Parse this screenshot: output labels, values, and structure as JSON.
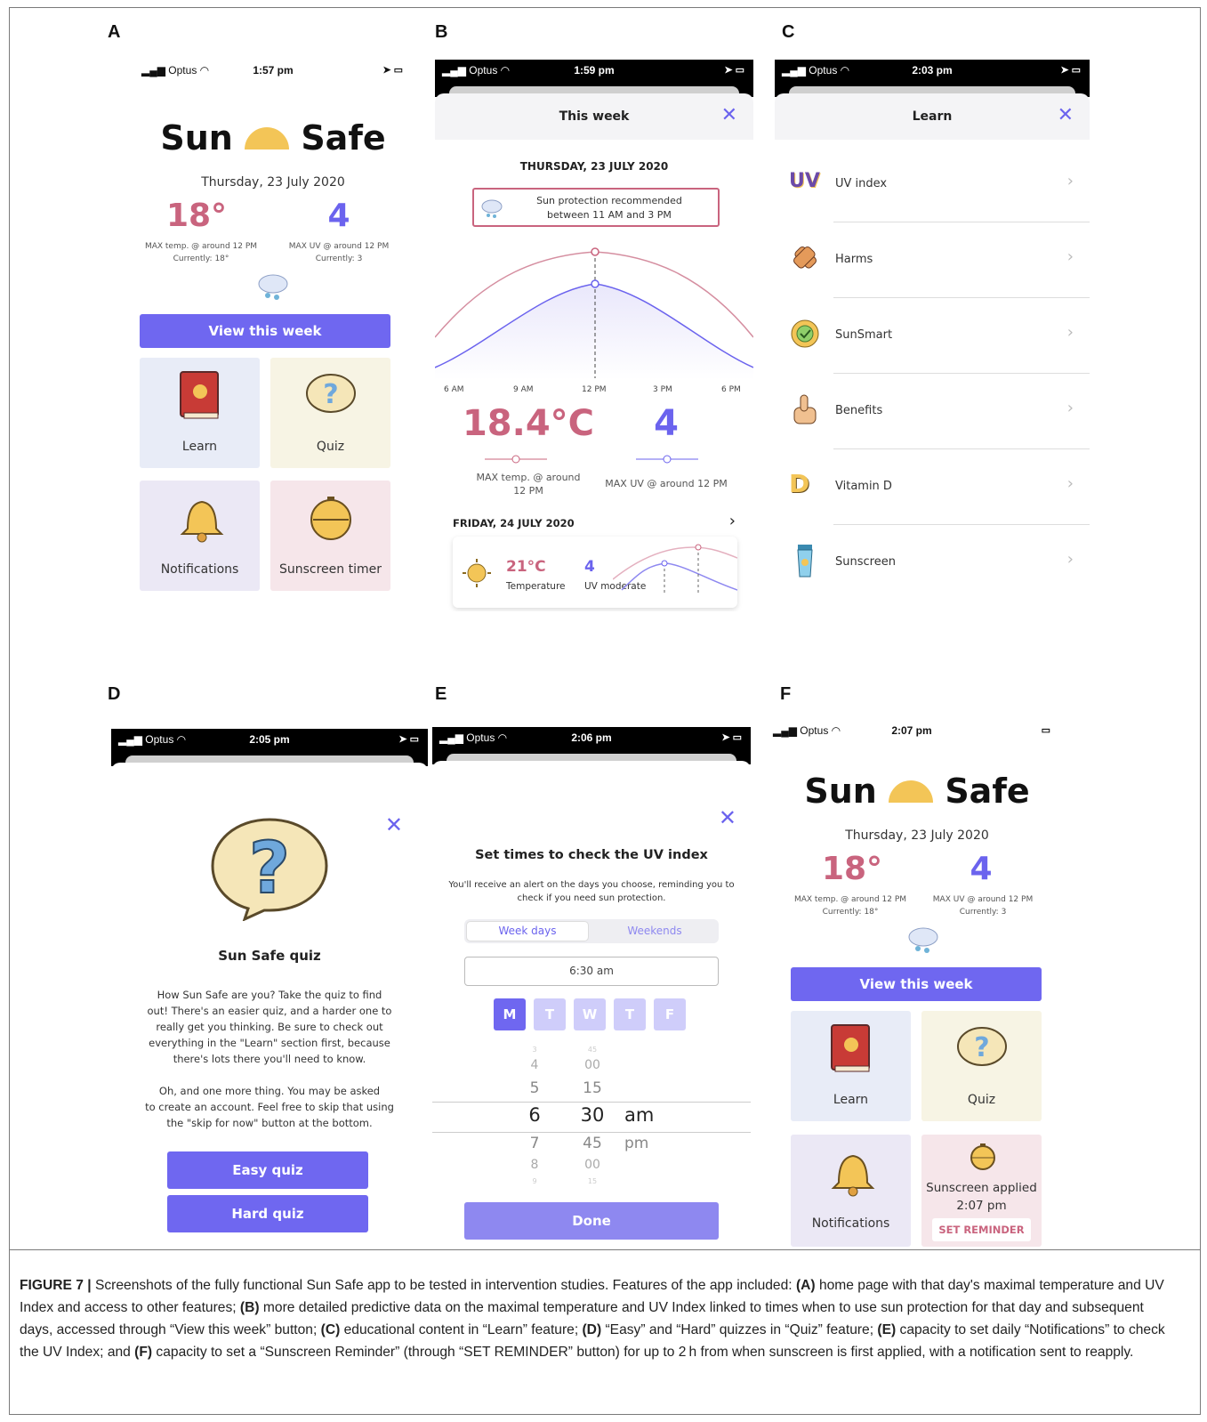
{
  "panels": {
    "A": {
      "letter": "A",
      "status": {
        "carrier": "Optus",
        "time": "1:57 pm"
      },
      "logo": {
        "left": "Sun",
        "right": "Safe"
      },
      "date": "Thursday, 23 July 2020",
      "temp": {
        "value": "18°",
        "label": "MAX temp. @ around 12 PM",
        "current": "Currently: 18°"
      },
      "uv": {
        "value": "4",
        "label": "MAX UV @ around 12 PM",
        "current": "Currently: 3"
      },
      "button": "View this week",
      "tiles": [
        "Learn",
        "Quiz",
        "Notifications",
        "Sunscreen timer"
      ]
    },
    "B": {
      "letter": "B",
      "status": {
        "carrier": "Optus",
        "time": "1:59 pm"
      },
      "title": "This week",
      "date": "THURSDAY, 23 JULY 2020",
      "alert_line1": "Sun protection recommended",
      "alert_line2": "between 11 AM and 3 PM",
      "x_ticks": [
        "6 AM",
        "9 AM",
        "12 PM",
        "3 PM",
        "6 PM"
      ],
      "temp": {
        "value": "18.4°C",
        "label_line1": "MAX temp. @ around",
        "label_line2": "12 PM"
      },
      "uv": {
        "value": "4",
        "label": "MAX UV @ around 12 PM"
      },
      "next_date": "FRIDAY, 24 JULY 2020",
      "next": {
        "temp": "21°C",
        "temp_label": "Temperature",
        "uv": "4",
        "uv_label": "UV moderate"
      }
    },
    "C": {
      "letter": "C",
      "status": {
        "carrier": "Optus",
        "time": "2:03 pm"
      },
      "title": "Learn",
      "items": [
        "UV index",
        "Harms",
        "SunSmart",
        "Benefits",
        "Vitamin D",
        "Sunscreen"
      ],
      "uv_badge": "UV",
      "vitd_badge": "D"
    },
    "D": {
      "letter": "D",
      "status": {
        "carrier": "Optus",
        "time": "2:05 pm"
      },
      "title": "Sun Safe quiz",
      "para1": [
        "How Sun Safe are you? Take the quiz to find",
        "out! There's an easier quiz, and a harder one to",
        "really get you thinking. Be sure to check out",
        "everything in the \"Learn\" section first, because",
        "there's lots there you'll need to know."
      ],
      "para2": [
        "Oh, and one more thing. You may be asked",
        "to create an account. Feel free to skip that using",
        "the \"skip for now\" button at the bottom."
      ],
      "easy": "Easy quiz",
      "hard": "Hard quiz"
    },
    "E": {
      "letter": "E",
      "status": {
        "carrier": "Optus",
        "time": "2:06 pm"
      },
      "title": "Set times to check the UV index",
      "sub1": "You'll receive an alert on the days you choose, reminding you to",
      "sub2": "check if you need sun protection.",
      "seg": [
        "Week days",
        "Weekends"
      ],
      "time_field": "6:30 am",
      "days": [
        "M",
        "T",
        "W",
        "T",
        "F"
      ],
      "picker_hours": [
        "3",
        "4",
        "5",
        "6",
        "7",
        "8",
        "9"
      ],
      "picker_mins": [
        "45",
        "00",
        "15",
        "30",
        "45",
        "00",
        "15"
      ],
      "picker_ampm": [
        "am",
        "pm"
      ],
      "done": "Done"
    },
    "F": {
      "letter": "F",
      "status": {
        "carrier": "Optus",
        "time": "2:07 pm"
      },
      "logo": {
        "left": "Sun",
        "right": "Safe"
      },
      "date": "Thursday, 23 July 2020",
      "temp": {
        "value": "18°",
        "label": "MAX temp. @ around 12 PM",
        "current": "Currently: 18°"
      },
      "uv": {
        "value": "4",
        "label": "MAX UV @ around 12 PM",
        "current": "Currently: 3"
      },
      "button": "View this week",
      "tiles": [
        "Learn",
        "Quiz",
        "Notifications"
      ],
      "sunscreen_applied": "Sunscreen applied",
      "sunscreen_time": "2:07 pm",
      "reminder": "SET REMINDER"
    }
  },
  "caption": {
    "lead": "FIGURE 7 |",
    "t0": " Screenshots of the fully functional Sun Safe app to be tested in intervention studies. Features of the app included: ",
    "a": "(A)",
    "t1": " home page with that day's maximal temperature and UV Index and access to other features; ",
    "b": "(B)",
    "t2": " more detailed predictive data on the maximal temperature and UV Index linked to times when to use sun protection for that day and subsequent days, accessed through “View this week” button; ",
    "c": "(C)",
    "t3": " educational content in “Learn” feature; ",
    "d": "(D)",
    "t4": " “Easy” and “Hard” quizzes in “Quiz” feature; ",
    "e": "(E)",
    "t5": " capacity to set daily “Notifications” to check the UV Index; and ",
    "f": "(F)",
    "t6": " capacity to set a “Sunscreen Reminder” (through “SET REMINDER” button) for up to 2 h from when sunscreen is first applied, with a notification sent to reapply."
  },
  "colors": {
    "accent": "#6f67f0",
    "pink": "#c9647e",
    "sun": "#f3c557",
    "tile_blue": "#e8ecf7",
    "tile_yellow": "#f7f4e4",
    "tile_lilac": "#ebe8f5",
    "tile_pink": "#f6e6ea"
  }
}
